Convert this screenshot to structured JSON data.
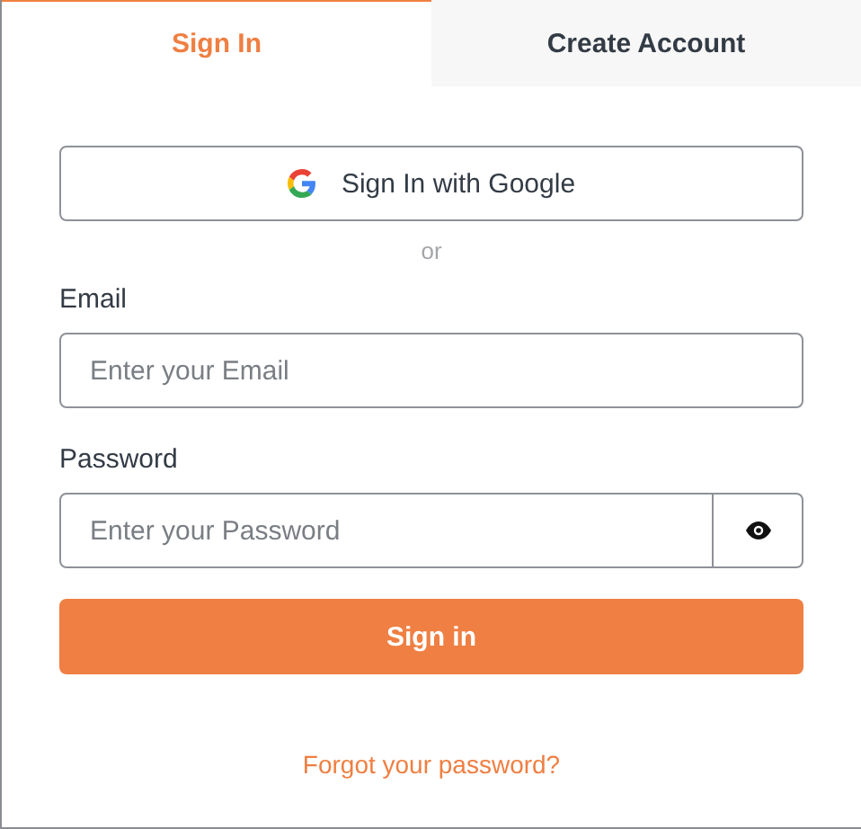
{
  "tabs": [
    {
      "label": "Sign In",
      "selected": true
    },
    {
      "label": "Create Account",
      "selected": false
    }
  ],
  "google_button": {
    "label": "Sign In with Google"
  },
  "separator": "or",
  "email": {
    "label": "Email",
    "placeholder": "Enter your Email"
  },
  "password": {
    "label": "Password",
    "placeholder": "Enter your Password"
  },
  "submit": {
    "label": "Sign in"
  },
  "forgot_link": "Forgot your password?"
}
